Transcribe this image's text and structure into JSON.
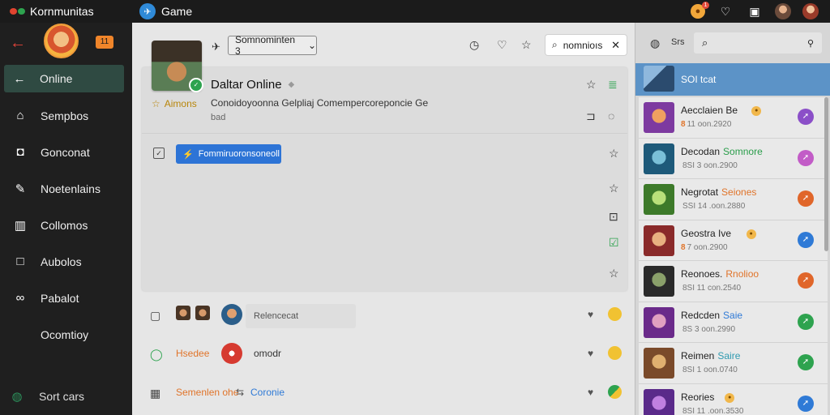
{
  "topbar": {
    "brand": "Kornmunitas",
    "game_tab": "Game",
    "game_logo_glyph": "✈",
    "notif_count": "1"
  },
  "sidebar": {
    "badge": "11",
    "items": [
      {
        "label": "Online",
        "icon": "arrow-left-icon",
        "glyph": "←"
      },
      {
        "label": "Sempbos",
        "icon": "home-icon",
        "glyph": "⌂"
      },
      {
        "label": "Gonconat",
        "icon": "chat-icon",
        "glyph": "◘"
      },
      {
        "label": "Noetenlains",
        "icon": "note-icon",
        "glyph": "✎"
      },
      {
        "label": "Collomos",
        "icon": "building-icon",
        "glyph": "▥"
      },
      {
        "label": "Aubolos",
        "icon": "square-icon",
        "glyph": "□"
      },
      {
        "label": "Pabalot",
        "icon": "binoculars-icon",
        "glyph": "∞"
      },
      {
        "label": "Ocomtioy",
        "icon": "",
        "glyph": ""
      }
    ],
    "footer": {
      "label": "Sort cars",
      "icon": "globe-icon",
      "glyph": "◍"
    }
  },
  "main": {
    "select_label": "Somnominten 3",
    "search_value": "nomnioıs",
    "card": {
      "title": "Daltar Online",
      "rating_label": "Aimons",
      "description": "Conoidoyoonna Gelpliaj Comempercoreponcie Ge",
      "subdescription": "bad",
      "button_label": "Fommiruoronsoneoll"
    },
    "rows": [
      {
        "pill": "Relencecat"
      },
      {
        "text": "Hsedee",
        "text2": "omodr"
      },
      {
        "text": "Semenlen ohe",
        "text2": "Coronie",
        "sep": "⇆"
      }
    ]
  },
  "rpanel": {
    "label": "Srs",
    "selected_title": "SOI tcat",
    "items": [
      {
        "name": "Aecclaien Be",
        "name2": "",
        "name2_color": "#222222",
        "meta_prefix": "8",
        "meta": "11 oon.2920",
        "action_color": "#8b4fc8",
        "coin": true,
        "thumb_a": "#7d3aa0",
        "thumb_b": "#f0a060"
      },
      {
        "name": "Decodan",
        "name2": "Somnore",
        "name2_color": "#2a9d4a",
        "meta_prefix": "",
        "meta": "8SI 3 oon.2900",
        "action_color": "#c25cc7",
        "coin": false,
        "thumb_a": "#1e5a7a",
        "thumb_b": "#7ac0d8"
      },
      {
        "name": "Negrotat",
        "name2": "Seiones",
        "name2_color": "#e0742a",
        "meta_prefix": "",
        "meta": "SSI 14 .oon.2880",
        "action_color": "#e0662a",
        "coin": false,
        "thumb_a": "#3d7a2a",
        "thumb_b": "#b9e07a"
      },
      {
        "name": "Geostra Ive",
        "name2": "",
        "name2_color": "#222222",
        "meta_prefix": "8",
        "meta": "7 oon.2900",
        "action_color": "#2f7ad6",
        "coin": true,
        "thumb_a": "#8a2a2a",
        "thumb_b": "#e8b080"
      },
      {
        "name": "Reonoes.",
        "name2": "Rnolioo",
        "name2_color": "#e0742a",
        "meta_prefix": "",
        "meta": "8SI 11 con.2540",
        "action_color": "#e0662a",
        "coin": false,
        "thumb_a": "#2a2a2a",
        "thumb_b": "#8aa06a"
      },
      {
        "name": "Redcden",
        "name2": "Saie",
        "name2_color": "#2f7ad6",
        "meta_prefix": "",
        "meta": "8S 3 oon.2990",
        "action_color": "#2ea34f",
        "coin": false,
        "thumb_a": "#6a2a8a",
        "thumb_b": "#e0a0c0"
      },
      {
        "name": "Reimen",
        "name2": "Saire",
        "name2_color": "#2f9ab0",
        "meta_prefix": "",
        "meta": "8SI 1 oon.0740",
        "action_color": "#2ea34f",
        "coin": false,
        "thumb_a": "#7a4a2a",
        "thumb_b": "#e0b070"
      },
      {
        "name": "Reories",
        "name2": "",
        "name2_color": "#222222",
        "meta_prefix": "",
        "meta": "8SI 11 .oon.3530",
        "action_color": "#2f7ad6",
        "coin": true,
        "thumb_a": "#5a2a8a",
        "thumb_b": "#c080e0"
      }
    ]
  },
  "colors": {
    "accent_green": "#2f4a42",
    "selected_blue": "#5c93c7",
    "button_blue": "#2d74d6",
    "brand_orange": "#f0852a"
  }
}
